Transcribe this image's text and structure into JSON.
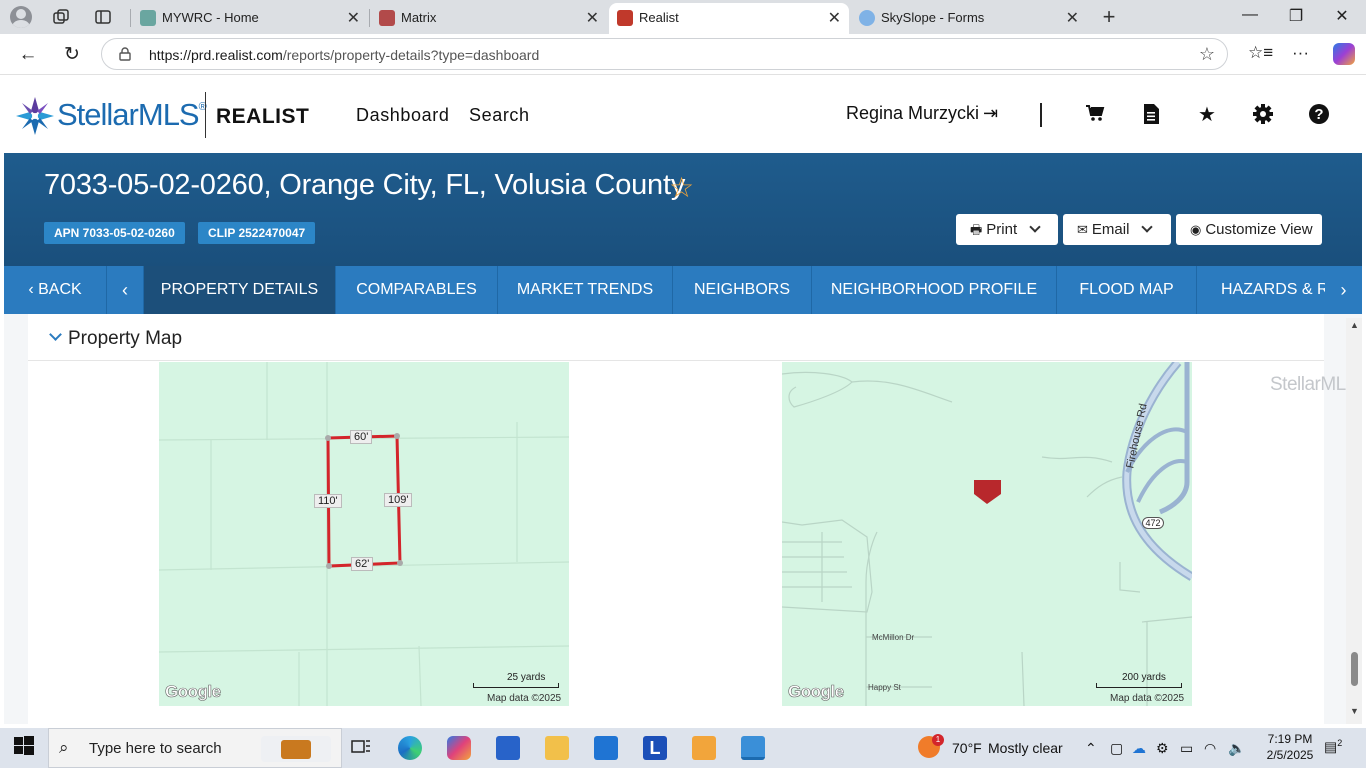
{
  "browser": {
    "tabs": [
      {
        "title": "MYWRC - Home",
        "active": false
      },
      {
        "title": "Matrix",
        "active": false
      },
      {
        "title": "Realist",
        "active": true
      },
      {
        "title": "SkySlope - Forms",
        "active": false
      }
    ],
    "url_host": "https://prd.realist.com",
    "url_path": "/reports/property-details?type=dashboard"
  },
  "header": {
    "brand": "StellarMLS",
    "brand_mark": "®",
    "product": "REALIST",
    "nav": [
      "Dashboard",
      "Search"
    ],
    "user": "Regina Murzycki",
    "separator": "|"
  },
  "banner": {
    "address": "7033-05-02-0260, Orange City, FL, Volusia County",
    "apn_badge": "APN 7033-05-02-0260",
    "clip_badge": "CLIP 2522470047",
    "print_label": "Print",
    "email_label": "Email",
    "customize_label": "Customize View"
  },
  "tabs": {
    "back": "BACK",
    "items": [
      "PROPERTY DETAILS",
      "COMPARABLES",
      "MARKET TRENDS",
      "NEIGHBORS",
      "NEIGHBORHOOD PROFILE",
      "FLOOD MAP",
      "HAZARDS & RI"
    ]
  },
  "section": {
    "title": "Property Map"
  },
  "parcel_map": {
    "dimensions": {
      "top": "60'",
      "left": "110'",
      "right": "109'",
      "bottom": "62'"
    },
    "scale": "25 yards",
    "map_data": "Map data ©2025",
    "google": "Google"
  },
  "area_map": {
    "road_firehouse": "Firehouse Rd",
    "road_mcmillon": "McMillon Dr",
    "road_happy": "Happy St",
    "route_shield": "472",
    "scale": "200 yards",
    "map_data": "Map data ©2025",
    "google": "Google"
  },
  "watermark": "StellarMLS",
  "taskbar": {
    "search_placeholder": "Type here to search",
    "weather_temp": "70°F",
    "weather_desc": "Mostly clear",
    "weather_badge": "1",
    "time": "7:19 PM",
    "date": "2/5/2025",
    "notifications": "2"
  }
}
